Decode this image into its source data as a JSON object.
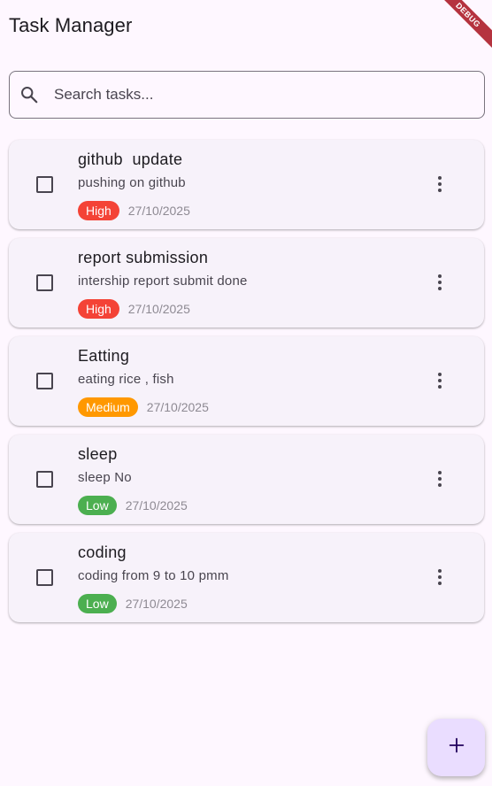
{
  "app_bar": {
    "title": "Task Manager",
    "debug_label": "DEBUG"
  },
  "search": {
    "placeholder": "Search tasks...",
    "value": "",
    "icon": "search-icon"
  },
  "priority_colors": {
    "High": "#f44336",
    "Medium": "#ff9800",
    "Low": "#4caf50"
  },
  "tasks": [
    {
      "title": "github  update",
      "description": "pushing on github",
      "priority": "High",
      "date": "27/10/2025",
      "completed": false
    },
    {
      "title": "report submission",
      "description": "intership report submit done",
      "priority": "High",
      "date": "27/10/2025",
      "completed": false
    },
    {
      "title": "Eatting",
      "description": "eating rice , fish",
      "priority": "Medium",
      "date": "27/10/2025",
      "completed": false
    },
    {
      "title": "sleep",
      "description": "sleep No",
      "priority": "Low",
      "date": "27/10/2025",
      "completed": false
    },
    {
      "title": "coding",
      "description": "coding from 9 to 10 pmm",
      "priority": "Low",
      "date": "27/10/2025",
      "completed": false
    }
  ],
  "fab": {
    "icon": "plus-icon"
  }
}
